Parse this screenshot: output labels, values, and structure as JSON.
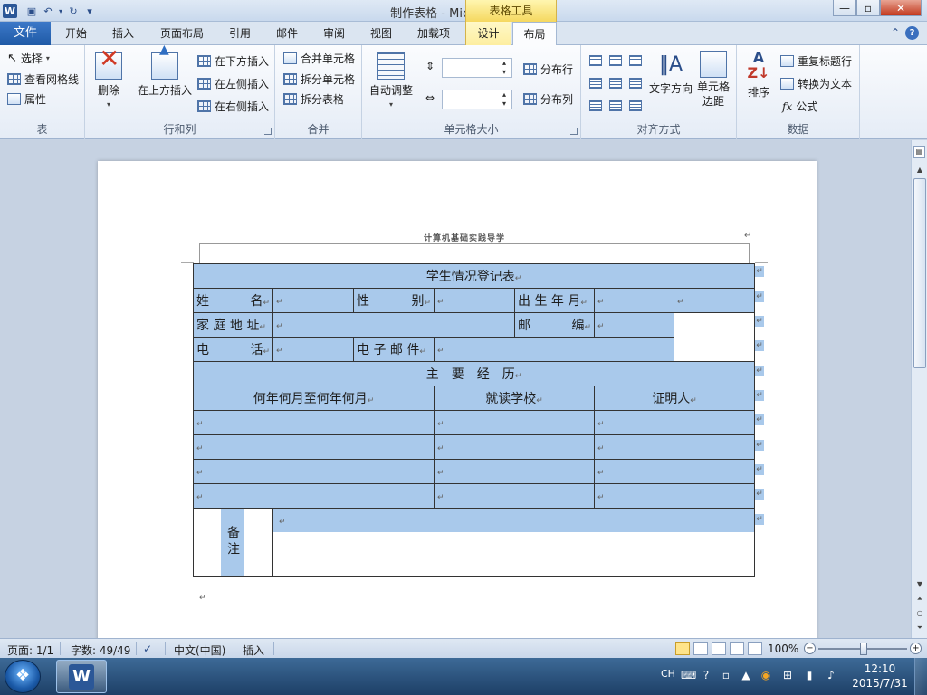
{
  "window": {
    "title": "制作表格 - Microsoft Word",
    "context_tab_group": "表格工具",
    "controls": {
      "minimize": "—",
      "maximize": "▫",
      "close": "✕"
    }
  },
  "quick_access": {
    "app_icon": "W",
    "save_icon": "save-icon",
    "undo": "↶",
    "redo": "↻",
    "customize": "▾"
  },
  "tabs": {
    "file": "文件",
    "items": [
      "开始",
      "插入",
      "页面布局",
      "引用",
      "邮件",
      "审阅",
      "视图",
      "加载项",
      "设计",
      "布局"
    ],
    "active": "布局"
  },
  "ribbon": {
    "table_group": {
      "label": "表",
      "select": "选择",
      "view_gridlines": "查看网格线",
      "properties": "属性"
    },
    "rows_cols_group": {
      "label": "行和列",
      "delete": "删除",
      "insert_above": "在上方插入",
      "insert_below": "在下方插入",
      "insert_left": "在左侧插入",
      "insert_right": "在右侧插入"
    },
    "merge_group": {
      "label": "合并",
      "merge_cells": "合并单元格",
      "split_cells": "拆分单元格",
      "split_table": "拆分表格"
    },
    "cell_size_group": {
      "label": "单元格大小",
      "autofit": "自动调整",
      "height_value": "",
      "width_value": "",
      "distribute_rows": "分布行",
      "distribute_cols": "分布列"
    },
    "alignment_group": {
      "label": "对齐方式",
      "text_direction": "文字方向",
      "cell_margins_line1": "单元格",
      "cell_margins_line2": "边距"
    },
    "data_group": {
      "label": "数据",
      "sort": "排序",
      "repeat_header": "重复标题行",
      "convert_to_text": "转换为文本",
      "formula": "公式",
      "formula_icon": "fx"
    }
  },
  "document": {
    "header_text": "计算机基础实践导学",
    "para_mark": "↵",
    "table": {
      "title": "学生情况登记表",
      "row1": {
        "name_label": [
          "姓",
          "名"
        ],
        "gender_label": [
          "性",
          "别"
        ],
        "birth_label": "出 生 年 月"
      },
      "row2": {
        "address_label": "家 庭 地 址",
        "postcode_label": [
          "邮",
          "编"
        ]
      },
      "row3": {
        "phone_label": [
          "电",
          "话"
        ],
        "email_label": "电 子 邮 件"
      },
      "section_title": "主　要　经　历",
      "columns": [
        "何年何月至何年何月",
        "就读学校",
        "证明人"
      ],
      "notes_label": "备注"
    }
  },
  "statusbar": {
    "page": "页面: 1/1",
    "words": "字数: 49/49",
    "language": "中文(中国)",
    "mode": "插入",
    "zoom": "100%",
    "zoom_minus": "−",
    "zoom_plus": "+"
  },
  "taskbar": {
    "ime": "CH",
    "clock_time": "12:10",
    "clock_date": "2015/7/31"
  },
  "colors": {
    "selection": "#a9c9eb",
    "file_tab": "#2b66b5",
    "table_tools": "#f5d860"
  }
}
